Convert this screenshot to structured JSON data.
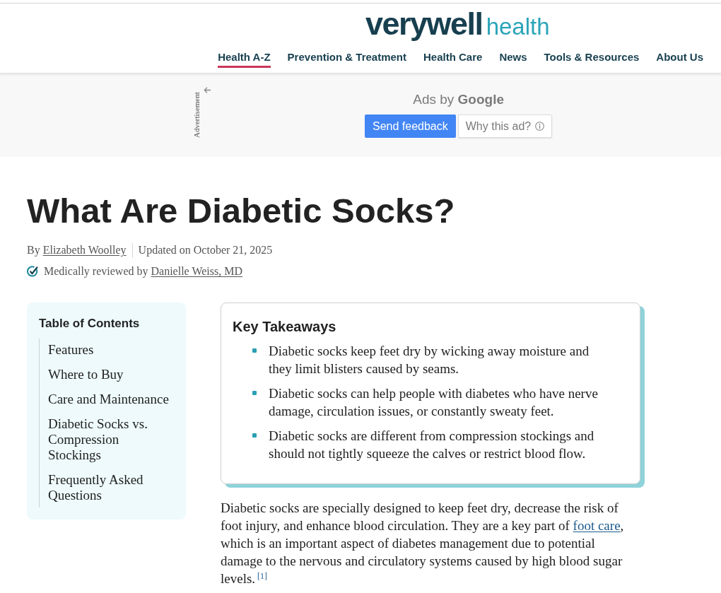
{
  "header": {
    "logo": {
      "brand": "verywell",
      "section": "health"
    },
    "nav": [
      {
        "label": "Health A-Z",
        "selected": true
      },
      {
        "label": "Prevention & Treatment",
        "selected": false
      },
      {
        "label": "Health Care",
        "selected": false
      },
      {
        "label": "News",
        "selected": false
      },
      {
        "label": "Tools & Resources",
        "selected": false
      },
      {
        "label": "About Us",
        "selected": false
      }
    ]
  },
  "ad": {
    "label": "Advertisement",
    "title": "Ads by **Google**",
    "buttons": [
      {
        "label": "Send feedback",
        "kind": "primary"
      },
      {
        "label": "Why this ad?",
        "kind": "info"
      }
    ]
  },
  "article": {
    "title": "What Are Diabetic Socks?",
    "byline": {
      "prefix": "By",
      "author": "Elizabeth Woolley",
      "updated": "Updated on October 21, 2025"
    },
    "review": {
      "prefix": "Medically reviewed by",
      "reviewer": "Danielle Weiss, MD"
    }
  },
  "toc": {
    "title": "Table of Contents",
    "items": [
      "Features",
      "Where to Buy",
      "Care and Maintenance",
      "Diabetic Socks vs. Compression Stockings",
      "Frequently Asked Questions"
    ]
  },
  "key_takeaways": {
    "title": "Key Takeaways",
    "items": [
      "Diabetic socks keep feet dry by wicking away moisture and they limit blisters caused by seams.",
      "Diabetic socks can help people with diabetes who have nerve damage, circulation issues, or constantly sweaty feet.",
      "Diabetic socks are different from compression stockings and should not tightly squeeze the calves or restrict blood flow."
    ]
  },
  "body": {
    "before": "Diabetic socks are specially designed to keep feet dry, decrease the risk of foot injury, and enhance blood circulation. They are a key part of ",
    "link": "foot care",
    "after": ", which is an important aspect of diabetes management due to potential damage to the nervous and circulatory systems caused by high blood sugar levels.",
    "footnote": "[1]"
  }
}
